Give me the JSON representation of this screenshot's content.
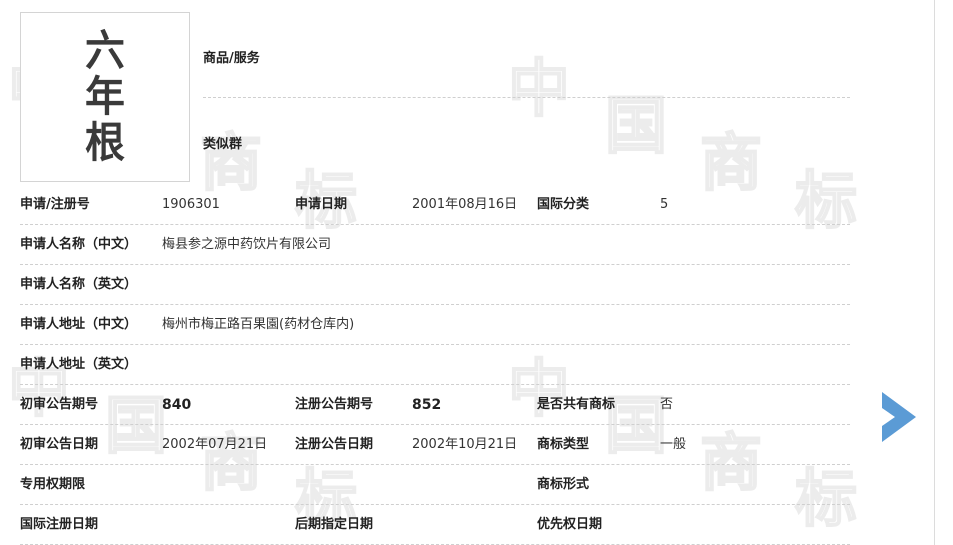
{
  "watermark": {
    "chars": [
      "中",
      "国",
      "商",
      "标"
    ]
  },
  "trademark": {
    "image_chars": [
      "六",
      "年",
      "根"
    ],
    "goods_label": "商品/服务",
    "goods_value": "",
    "similar_group_label": "类似群",
    "similar_group_value": ""
  },
  "details": {
    "reg_no_label": "申请/注册号",
    "reg_no": "1906301",
    "apply_date_label": "申请日期",
    "apply_date": "2001年08月16日",
    "intl_class_label": "国际分类",
    "intl_class": "5",
    "applicant_cn_label": "申请人名称（中文）",
    "applicant_cn": "梅县参之源中药饮片有限公司",
    "applicant_en_label": "申请人名称（英文）",
    "applicant_en": "",
    "address_cn_label": "申请人地址（中文）",
    "address_cn": "梅州市梅正路百果園(药材仓库内)",
    "address_en_label": "申请人地址（英文）",
    "address_en": "",
    "prelim_issue_label": "初审公告期号",
    "prelim_issue": "840",
    "reg_issue_label": "注册公告期号",
    "reg_issue": "852",
    "shared_label": "是否共有商标",
    "shared": "否",
    "prelim_date_label": "初审公告日期",
    "prelim_date": "2002年07月21日",
    "reg_date_label": "注册公告日期",
    "reg_date": "2002年10月21日",
    "tm_type_label": "商标类型",
    "tm_type": "一般",
    "exclusive_period_label": "专用权期限",
    "exclusive_period": "",
    "tm_form_label": "商标形式",
    "tm_form": "",
    "intl_reg_date_label": "国际注册日期",
    "intl_reg_date": "",
    "later_designation_label": "后期指定日期",
    "later_designation": "",
    "priority_date_label": "优先权日期",
    "priority_date": ""
  },
  "nav": {
    "next_icon": "chevron-right-icon",
    "arrow_color": "#5b9bd5"
  }
}
